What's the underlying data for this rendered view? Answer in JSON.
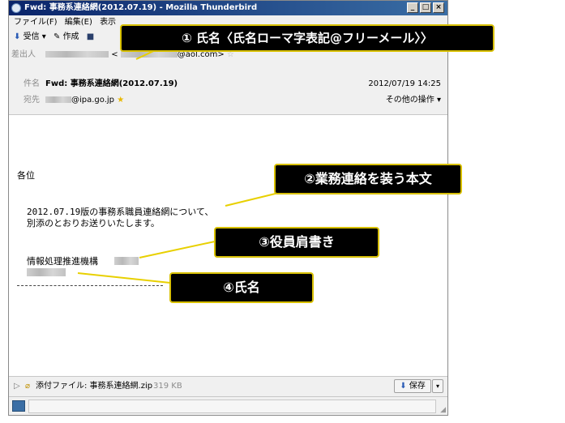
{
  "window": {
    "title": "Fwd: 事務系連絡網(2012.07.19) - Mozilla Thunderbird",
    "btn_min": "_",
    "btn_max": "□",
    "btn_close": "×"
  },
  "menu": {
    "file": "ファイル(F)",
    "edit": "編集(E)",
    "view": "表示"
  },
  "toolbar": {
    "receive": "受信",
    "receive_arrow": "▾",
    "compose": "作成"
  },
  "header": {
    "from_label": "差出人",
    "from_lt": "<",
    "from_domain": "@aol.com>",
    "subject_label": "件名",
    "subject": "Fwd: 事務系連絡網(2012.07.19)",
    "date": "2012/07/19 14:25",
    "to_label": "宛先",
    "to_domain": "@ipa.go.jp",
    "other_actions": "その他の操作 ▾"
  },
  "body": {
    "greeting": "各位",
    "line1": "2012.07.19版の事務系職員連絡網について、",
    "line2": "別添のとおりお送りいたします。",
    "org": "情報処理推進機構"
  },
  "attachment": {
    "label": "添付ファイル: 事務系連絡網.zip",
    "size": "319 KB",
    "save": "保存"
  },
  "callouts": {
    "c1": "① 氏名〈氏名ローマ字表記@フリーメール〉〉",
    "c2": "②業務連絡を装う本文",
    "c3": "③役員肩書き",
    "c4": "④氏名"
  },
  "colors": {
    "callout_bg": "#000000",
    "callout_border": "#d8c000",
    "leader_line": "#e8d000",
    "titlebar": "#0a246a"
  }
}
